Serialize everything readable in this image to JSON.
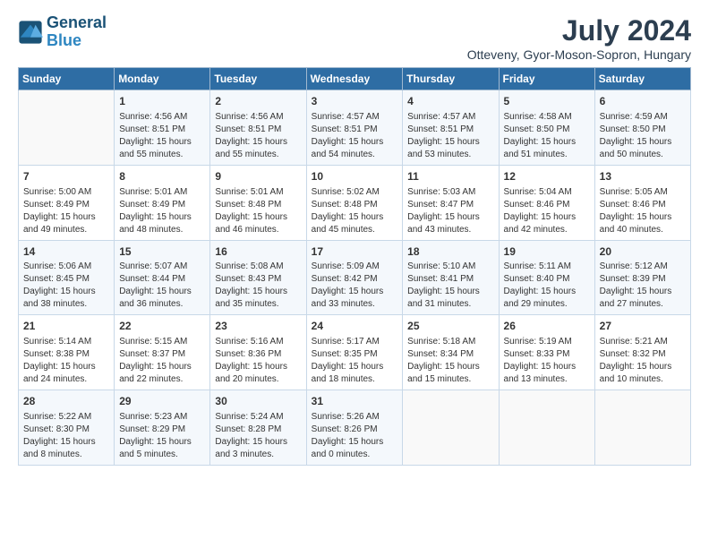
{
  "header": {
    "logo_line1": "General",
    "logo_line2": "Blue",
    "month_year": "July 2024",
    "location": "Otteveny, Gyor-Moson-Sopron, Hungary"
  },
  "columns": [
    "Sunday",
    "Monday",
    "Tuesday",
    "Wednesday",
    "Thursday",
    "Friday",
    "Saturday"
  ],
  "weeks": [
    [
      {
        "day": "",
        "content": ""
      },
      {
        "day": "1",
        "content": "Sunrise: 4:56 AM\nSunset: 8:51 PM\nDaylight: 15 hours\nand 55 minutes."
      },
      {
        "day": "2",
        "content": "Sunrise: 4:56 AM\nSunset: 8:51 PM\nDaylight: 15 hours\nand 55 minutes."
      },
      {
        "day": "3",
        "content": "Sunrise: 4:57 AM\nSunset: 8:51 PM\nDaylight: 15 hours\nand 54 minutes."
      },
      {
        "day": "4",
        "content": "Sunrise: 4:57 AM\nSunset: 8:51 PM\nDaylight: 15 hours\nand 53 minutes."
      },
      {
        "day": "5",
        "content": "Sunrise: 4:58 AM\nSunset: 8:50 PM\nDaylight: 15 hours\nand 51 minutes."
      },
      {
        "day": "6",
        "content": "Sunrise: 4:59 AM\nSunset: 8:50 PM\nDaylight: 15 hours\nand 50 minutes."
      }
    ],
    [
      {
        "day": "7",
        "content": "Sunrise: 5:00 AM\nSunset: 8:49 PM\nDaylight: 15 hours\nand 49 minutes."
      },
      {
        "day": "8",
        "content": "Sunrise: 5:01 AM\nSunset: 8:49 PM\nDaylight: 15 hours\nand 48 minutes."
      },
      {
        "day": "9",
        "content": "Sunrise: 5:01 AM\nSunset: 8:48 PM\nDaylight: 15 hours\nand 46 minutes."
      },
      {
        "day": "10",
        "content": "Sunrise: 5:02 AM\nSunset: 8:48 PM\nDaylight: 15 hours\nand 45 minutes."
      },
      {
        "day": "11",
        "content": "Sunrise: 5:03 AM\nSunset: 8:47 PM\nDaylight: 15 hours\nand 43 minutes."
      },
      {
        "day": "12",
        "content": "Sunrise: 5:04 AM\nSunset: 8:46 PM\nDaylight: 15 hours\nand 42 minutes."
      },
      {
        "day": "13",
        "content": "Sunrise: 5:05 AM\nSunset: 8:46 PM\nDaylight: 15 hours\nand 40 minutes."
      }
    ],
    [
      {
        "day": "14",
        "content": "Sunrise: 5:06 AM\nSunset: 8:45 PM\nDaylight: 15 hours\nand 38 minutes."
      },
      {
        "day": "15",
        "content": "Sunrise: 5:07 AM\nSunset: 8:44 PM\nDaylight: 15 hours\nand 36 minutes."
      },
      {
        "day": "16",
        "content": "Sunrise: 5:08 AM\nSunset: 8:43 PM\nDaylight: 15 hours\nand 35 minutes."
      },
      {
        "day": "17",
        "content": "Sunrise: 5:09 AM\nSunset: 8:42 PM\nDaylight: 15 hours\nand 33 minutes."
      },
      {
        "day": "18",
        "content": "Sunrise: 5:10 AM\nSunset: 8:41 PM\nDaylight: 15 hours\nand 31 minutes."
      },
      {
        "day": "19",
        "content": "Sunrise: 5:11 AM\nSunset: 8:40 PM\nDaylight: 15 hours\nand 29 minutes."
      },
      {
        "day": "20",
        "content": "Sunrise: 5:12 AM\nSunset: 8:39 PM\nDaylight: 15 hours\nand 27 minutes."
      }
    ],
    [
      {
        "day": "21",
        "content": "Sunrise: 5:14 AM\nSunset: 8:38 PM\nDaylight: 15 hours\nand 24 minutes."
      },
      {
        "day": "22",
        "content": "Sunrise: 5:15 AM\nSunset: 8:37 PM\nDaylight: 15 hours\nand 22 minutes."
      },
      {
        "day": "23",
        "content": "Sunrise: 5:16 AM\nSunset: 8:36 PM\nDaylight: 15 hours\nand 20 minutes."
      },
      {
        "day": "24",
        "content": "Sunrise: 5:17 AM\nSunset: 8:35 PM\nDaylight: 15 hours\nand 18 minutes."
      },
      {
        "day": "25",
        "content": "Sunrise: 5:18 AM\nSunset: 8:34 PM\nDaylight: 15 hours\nand 15 minutes."
      },
      {
        "day": "26",
        "content": "Sunrise: 5:19 AM\nSunset: 8:33 PM\nDaylight: 15 hours\nand 13 minutes."
      },
      {
        "day": "27",
        "content": "Sunrise: 5:21 AM\nSunset: 8:32 PM\nDaylight: 15 hours\nand 10 minutes."
      }
    ],
    [
      {
        "day": "28",
        "content": "Sunrise: 5:22 AM\nSunset: 8:30 PM\nDaylight: 15 hours\nand 8 minutes."
      },
      {
        "day": "29",
        "content": "Sunrise: 5:23 AM\nSunset: 8:29 PM\nDaylight: 15 hours\nand 5 minutes."
      },
      {
        "day": "30",
        "content": "Sunrise: 5:24 AM\nSunset: 8:28 PM\nDaylight: 15 hours\nand 3 minutes."
      },
      {
        "day": "31",
        "content": "Sunrise: 5:26 AM\nSunset: 8:26 PM\nDaylight: 15 hours\nand 0 minutes."
      },
      {
        "day": "",
        "content": ""
      },
      {
        "day": "",
        "content": ""
      },
      {
        "day": "",
        "content": ""
      }
    ]
  ]
}
